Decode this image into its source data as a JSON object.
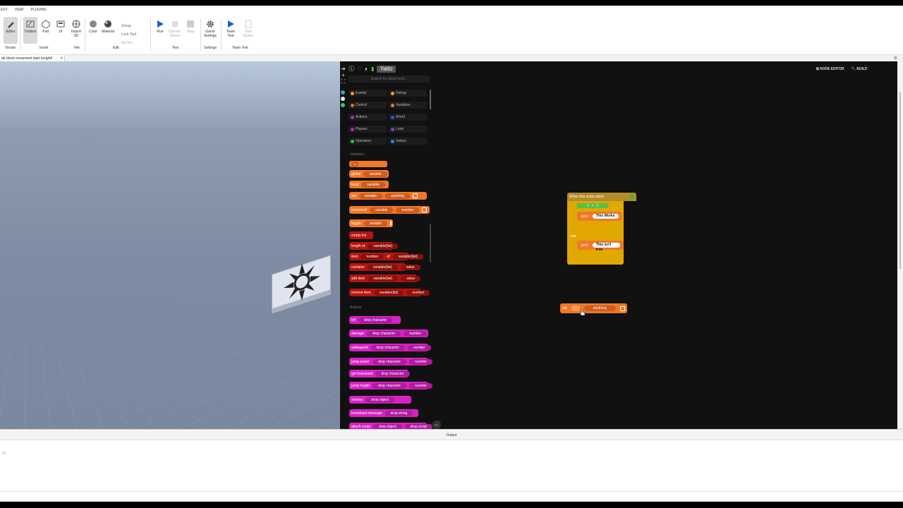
{
  "menu": [
    "EST",
    "VIEW",
    "PLUGINS"
  ],
  "ribbon": {
    "tools": [
      {
        "label": "Editor",
        "selected": true
      },
      {
        "label": "Toolbox",
        "selected": true
      },
      {
        "label": "Part"
      },
      {
        "label": "UI"
      },
      {
        "label": "Import\n3D"
      },
      {
        "label": "Color"
      },
      {
        "label": "Material"
      },
      {
        "label": "Run"
      },
      {
        "label": "Current:\nServer",
        "dim": true
      },
      {
        "label": "Stop",
        "dim": true
      },
      {
        "label": "Game\nSettings"
      },
      {
        "label": "Team\nTest"
      },
      {
        "label": "Exit\nGame",
        "dim": true
      }
    ],
    "group_opts": [
      "Group",
      "Lock Tool",
      "Anchor"
    ],
    "groups": [
      "Terrain",
      "Insert",
      "File",
      "Edit",
      "Test",
      "Settings",
      "Team Test"
    ]
  },
  "tab": {
    "label": "de block movement start tonight!",
    "close": "×"
  },
  "editor": {
    "logo": "Yatto",
    "search_placeholder": "Search for block here...",
    "categories": [
      {
        "label": "Events",
        "color": "#f0a020"
      },
      {
        "label": "Debug",
        "color": "#f0a020"
      },
      {
        "label": "Control",
        "color": "#e07020"
      },
      {
        "label": "Variables",
        "color": "#f07828"
      },
      {
        "label": "Actions",
        "color": "#c020c0"
      },
      {
        "label": "World",
        "color": "#2060d0"
      },
      {
        "label": "Players",
        "color": "#c020c0"
      },
      {
        "label": "Look",
        "color": "#8040d0"
      },
      {
        "label": "Operators",
        "color": "#30c040"
      },
      {
        "label": "Values",
        "color": "#2090e0"
      }
    ],
    "section_variables": "Variables",
    "section_actions": "Actions",
    "var_blocks": [
      {
        "parts": [
          "global",
          "variable"
        ]
      },
      {
        "parts": [
          "local",
          "variable"
        ]
      },
      {
        "parts": [
          "set",
          "variable",
          "anything"
        ]
      },
      {
        "parts": [
          "increment",
          "variable",
          "number"
        ]
      },
      {
        "parts": [
          "toggle",
          "variable"
        ]
      },
      {
        "parts": [
          "empty list"
        ]
      },
      {
        "parts": [
          "length of",
          "variable(list)"
        ]
      },
      {
        "parts": [
          "item",
          "number",
          "of",
          "variable(list)"
        ]
      },
      {
        "parts": [
          "contains",
          "variable(list)",
          "value"
        ]
      },
      {
        "parts": [
          "add item",
          "variable(list)",
          "value"
        ]
      },
      {
        "parts": [
          "remove item",
          "variable(list)",
          "number"
        ]
      }
    ],
    "action_blocks": [
      {
        "parts": [
          "kill",
          "drop character"
        ]
      },
      {
        "parts": [
          "damage",
          "drop character",
          "number"
        ]
      },
      {
        "parts": [
          "walkspeed",
          "drop character",
          "number"
        ]
      },
      {
        "parts": [
          "jump power",
          "drop character",
          "number"
        ]
      },
      {
        "parts": [
          "get humanoid",
          "drop character"
        ]
      },
      {
        "parts": [
          "jump height",
          "drop character",
          "number"
        ]
      },
      {
        "parts": [
          "destroy",
          "drop object"
        ]
      },
      {
        "parts": [
          "broadcast message",
          "drop string"
        ]
      },
      {
        "parts": [
          "attach script",
          "drop object",
          "drop script"
        ]
      }
    ],
    "node_editor": "NODE EDITOR",
    "build": "BUILD",
    "script": {
      "event": "When this script starts",
      "cond_a": "1",
      "cond_b": "1",
      "print_label": "print",
      "print_true": "This Works",
      "else_label": "else",
      "print_false": "This isn't true"
    },
    "set_block": {
      "label": "set",
      "value": "anything"
    }
  },
  "output": {
    "title": "Output",
    "line": ":21"
  }
}
